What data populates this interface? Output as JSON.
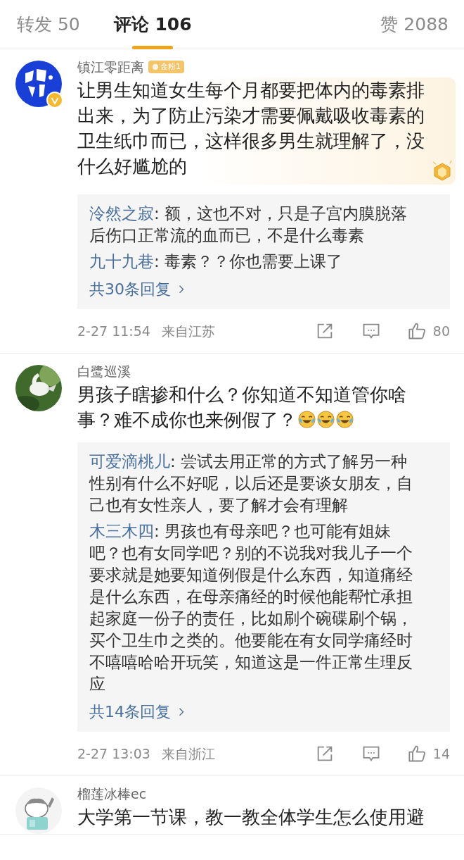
{
  "tabs": [
    {
      "label": "转发",
      "count": "50",
      "selected": false
    },
    {
      "label": "评论",
      "count": "106",
      "selected": true
    },
    {
      "label": "赞",
      "count": "2088",
      "selected": false
    }
  ],
  "comments": [
    {
      "author": "镇江零距离",
      "badge": "金粉1",
      "verified": true,
      "highlighted": true,
      "text": "让男生知道女生每个月都要把体内的毒素排出来，为了防止污染才需要佩戴吸收毒素的卫生纸巾而已，这样很多男生就理解了，没什么好尴尬的",
      "replies": [
        {
          "author": "泠然之寂",
          "text": ": 额，这也不对，只是子宫内膜脱落后伤口正常流的血而已，不是什么毒素"
        },
        {
          "author": "九十九巷",
          "text": ": 毒素？？你也需要上课了"
        }
      ],
      "more_replies": "共30条回复",
      "time": "2-27 11:54",
      "location": "来自江苏",
      "likes": "80"
    },
    {
      "author": "白鹭巡溪",
      "verified": false,
      "highlighted": false,
      "text": "男孩子瞎掺和什么？你知道不知道管你啥事？难不成你也来例假了？",
      "emojis": [
        {
          "kind": "laugh-cry"
        },
        {
          "kind": "laugh-cry"
        },
        {
          "kind": "laugh-cry"
        }
      ],
      "replies": [
        {
          "author": "可爱滴桃儿",
          "text": ": 尝试去用正常的方式了解另一种性别有什么不好呢，以后还是要谈女朋友，自己也有女性亲人，要了解才会有理解"
        },
        {
          "author": "木三木四",
          "text": ": 男孩也有母亲吧？也可能有姐妹吧？也有女同学吧？别的不说我对我儿子一个要求就是她要知道例假是什么东西，知道痛经是什么东西，在母亲痛经的时候他能帮忙承担起家庭一份子的责任，比如刷个碗碟刷个锅，买个卫生巾之类的。他要能在有女同学痛经时不嘻嘻哈哈开玩笑，知道这是一件正常生理反应"
        }
      ],
      "more_replies": "共14条回复",
      "time": "2-27 13:03",
      "location": "来自浙江",
      "likes": "14"
    },
    {
      "author": "榴莲冰棒ec",
      "verified": false,
      "highlighted": false,
      "text": "大学第一节课，教一教全体学生怎么使用避"
    }
  ]
}
